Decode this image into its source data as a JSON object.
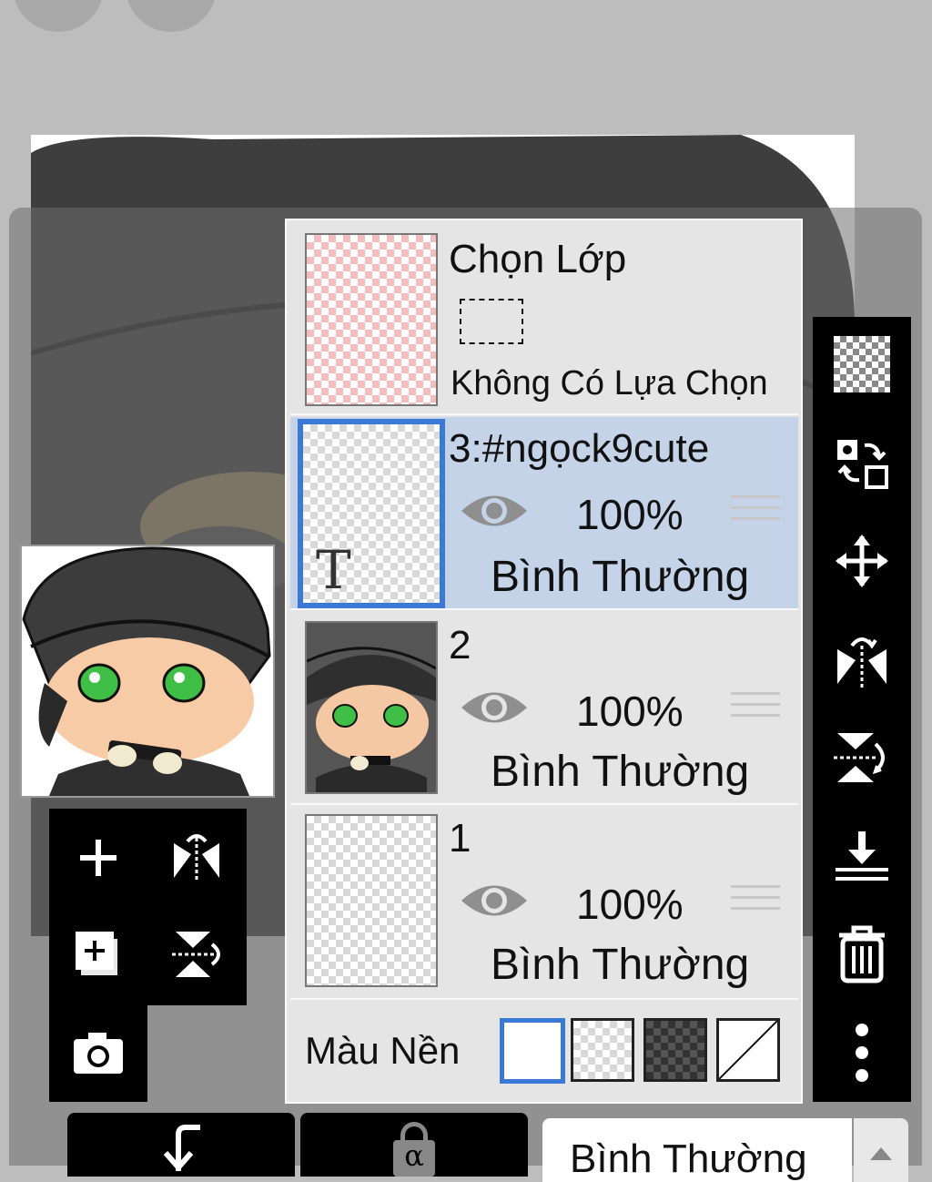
{
  "layer_panel": {
    "selection": {
      "title": "Chọn Lớp",
      "status": "Không Có Lựa Chọn"
    },
    "layers": [
      {
        "name": "3:#ngọck9cute",
        "opacity": "100%",
        "blend": "Bình Thường",
        "selected": true,
        "type": "text",
        "type_glyph": "T"
      },
      {
        "name": "2",
        "opacity": "100%",
        "blend": "Bình Thường",
        "selected": false
      },
      {
        "name": "1",
        "opacity": "100%",
        "blend": "Bình Thường",
        "selected": false
      }
    ],
    "background": {
      "label": "Màu Nền",
      "options": [
        "white",
        "transparent",
        "dark-checker",
        "none"
      ],
      "selected": "white"
    }
  },
  "bottom_bar": {
    "blend_mode": "Bình Thường",
    "alpha_lock_glyph": "α"
  },
  "colors": {
    "accent": "#3a79d6",
    "selected_row": "#c5d3e8",
    "panel": "#e5e5e5",
    "toolbar": "#000000"
  }
}
